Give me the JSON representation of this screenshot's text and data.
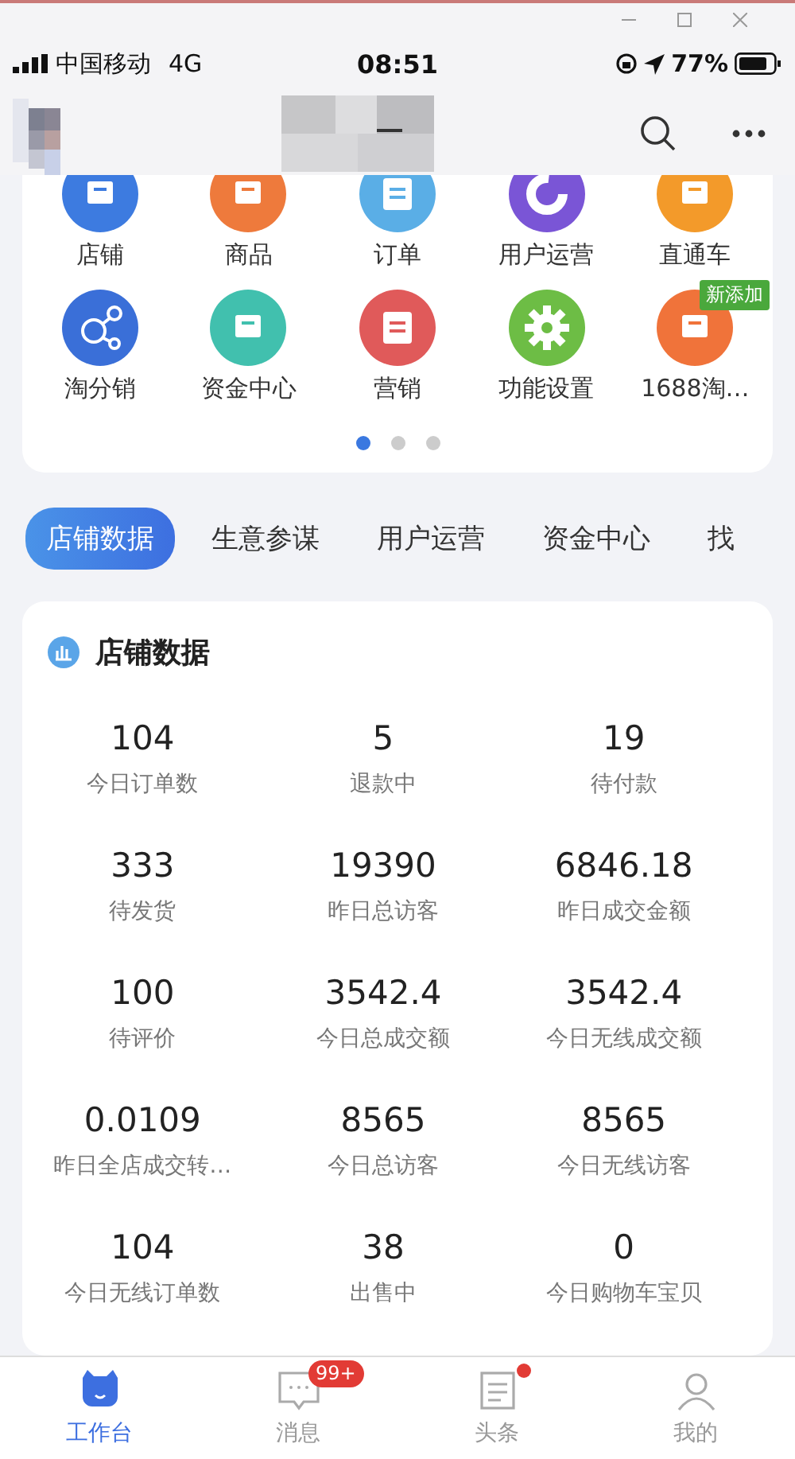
{
  "status_bar": {
    "carrier": "中国移动",
    "network": "4G",
    "time": "08:51",
    "battery": "77%"
  },
  "shortcuts": {
    "items": [
      {
        "label": "店铺",
        "kind": "box",
        "color": "#3d7be0"
      },
      {
        "label": "商品",
        "kind": "box",
        "color": "#ee7a3c"
      },
      {
        "label": "订单",
        "kind": "doc",
        "color": "#5aaee6"
      },
      {
        "label": "用户运营",
        "kind": "ring",
        "color": "#7a55d6"
      },
      {
        "label": "直通车",
        "kind": "box",
        "color": "#f39a2a"
      },
      {
        "label": "淘分销",
        "kind": "share",
        "color": "#3a6fd8"
      },
      {
        "label": "资金中心",
        "kind": "box",
        "color": "#41c0ae"
      },
      {
        "label": "营销",
        "kind": "doc",
        "color": "#e05a5a"
      },
      {
        "label": "功能设置",
        "kind": "gear",
        "color": "#6dbd45"
      },
      {
        "label": "1688淘…",
        "kind": "box",
        "color": "#f0733a",
        "badge": "新添加"
      }
    ],
    "pages": [
      {
        "selected": true
      },
      {
        "selected": false
      },
      {
        "selected": false
      }
    ]
  },
  "tabs": [
    {
      "label": "店铺数据",
      "selected": true
    },
    {
      "label": "生意参谋",
      "selected": false
    },
    {
      "label": "用户运营",
      "selected": false
    },
    {
      "label": "资金中心",
      "selected": false
    },
    {
      "label": "找",
      "selected": false
    }
  ],
  "store_data": {
    "title": "店铺数据",
    "metrics": [
      {
        "value": "104",
        "label": "今日订单数"
      },
      {
        "value": "5",
        "label": "退款中"
      },
      {
        "value": "19",
        "label": "待付款"
      },
      {
        "value": "333",
        "label": "待发货"
      },
      {
        "value": "19390",
        "label": "昨日总访客"
      },
      {
        "value": "6846.18",
        "label": "昨日成交金额"
      },
      {
        "value": "100",
        "label": "待评价"
      },
      {
        "value": "3542.4",
        "label": "今日总成交额"
      },
      {
        "value": "3542.4",
        "label": "今日无线成交额"
      },
      {
        "value": "0.0109",
        "label": "昨日全店成交转…"
      },
      {
        "value": "8565",
        "label": "今日总访客"
      },
      {
        "value": "8565",
        "label": "今日无线访客"
      },
      {
        "value": "104",
        "label": "今日无线订单数"
      },
      {
        "value": "38",
        "label": "出售中"
      },
      {
        "value": "0",
        "label": "今日购物车宝贝"
      }
    ]
  },
  "bottom_tabs": [
    {
      "label": "工作台",
      "kind": "home",
      "selected": true
    },
    {
      "label": "消息",
      "kind": "chat",
      "selected": false,
      "badge": "99+"
    },
    {
      "label": "头条",
      "kind": "news",
      "selected": false,
      "dot": true
    },
    {
      "label": "我的",
      "kind": "user",
      "selected": false
    }
  ]
}
